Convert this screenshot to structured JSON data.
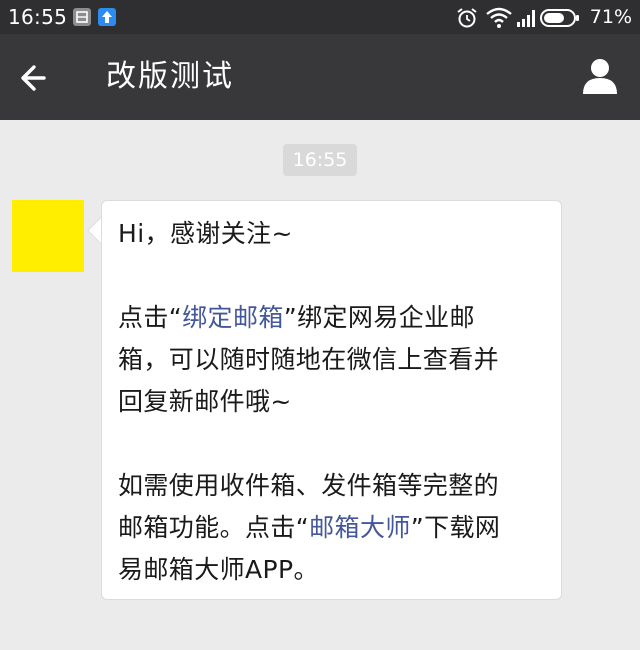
{
  "status_bar": {
    "time": "16:55",
    "battery_percent": "71%",
    "battery_level": 0.71,
    "notification_icons": [
      "storage-icon",
      "upload-icon"
    ],
    "system_icons": [
      "alarm-icon",
      "wifi-icon",
      "signal-icon",
      "battery-icon"
    ]
  },
  "header": {
    "title": "改版测试",
    "back_icon": "back-arrow-icon",
    "profile_icon": "person-icon"
  },
  "chat": {
    "timestamp": "16:55",
    "message": {
      "greeting": "Hi，感谢关注~",
      "p2_before": "点击“",
      "p2_link": "绑定邮箱",
      "p2_mid": "”绑定网易企业邮",
      "p2_line2": "箱，可以随时随地在微信上查看并",
      "p2_line3": "回复新邮件哦~",
      "p3_line1": "如需使用收件箱、发件箱等完整的",
      "p3_before": "邮箱功能。点击“",
      "p3_link": "邮箱大师",
      "p3_after": "”下载网",
      "p3_line3": "易邮箱大师APP。"
    }
  },
  "colors": {
    "status_bar_bg": "#2f2f31",
    "title_bar_bg": "#38383a",
    "chat_bg": "#ebebeb",
    "link": "#44579b",
    "avatar": "#ffee00"
  }
}
